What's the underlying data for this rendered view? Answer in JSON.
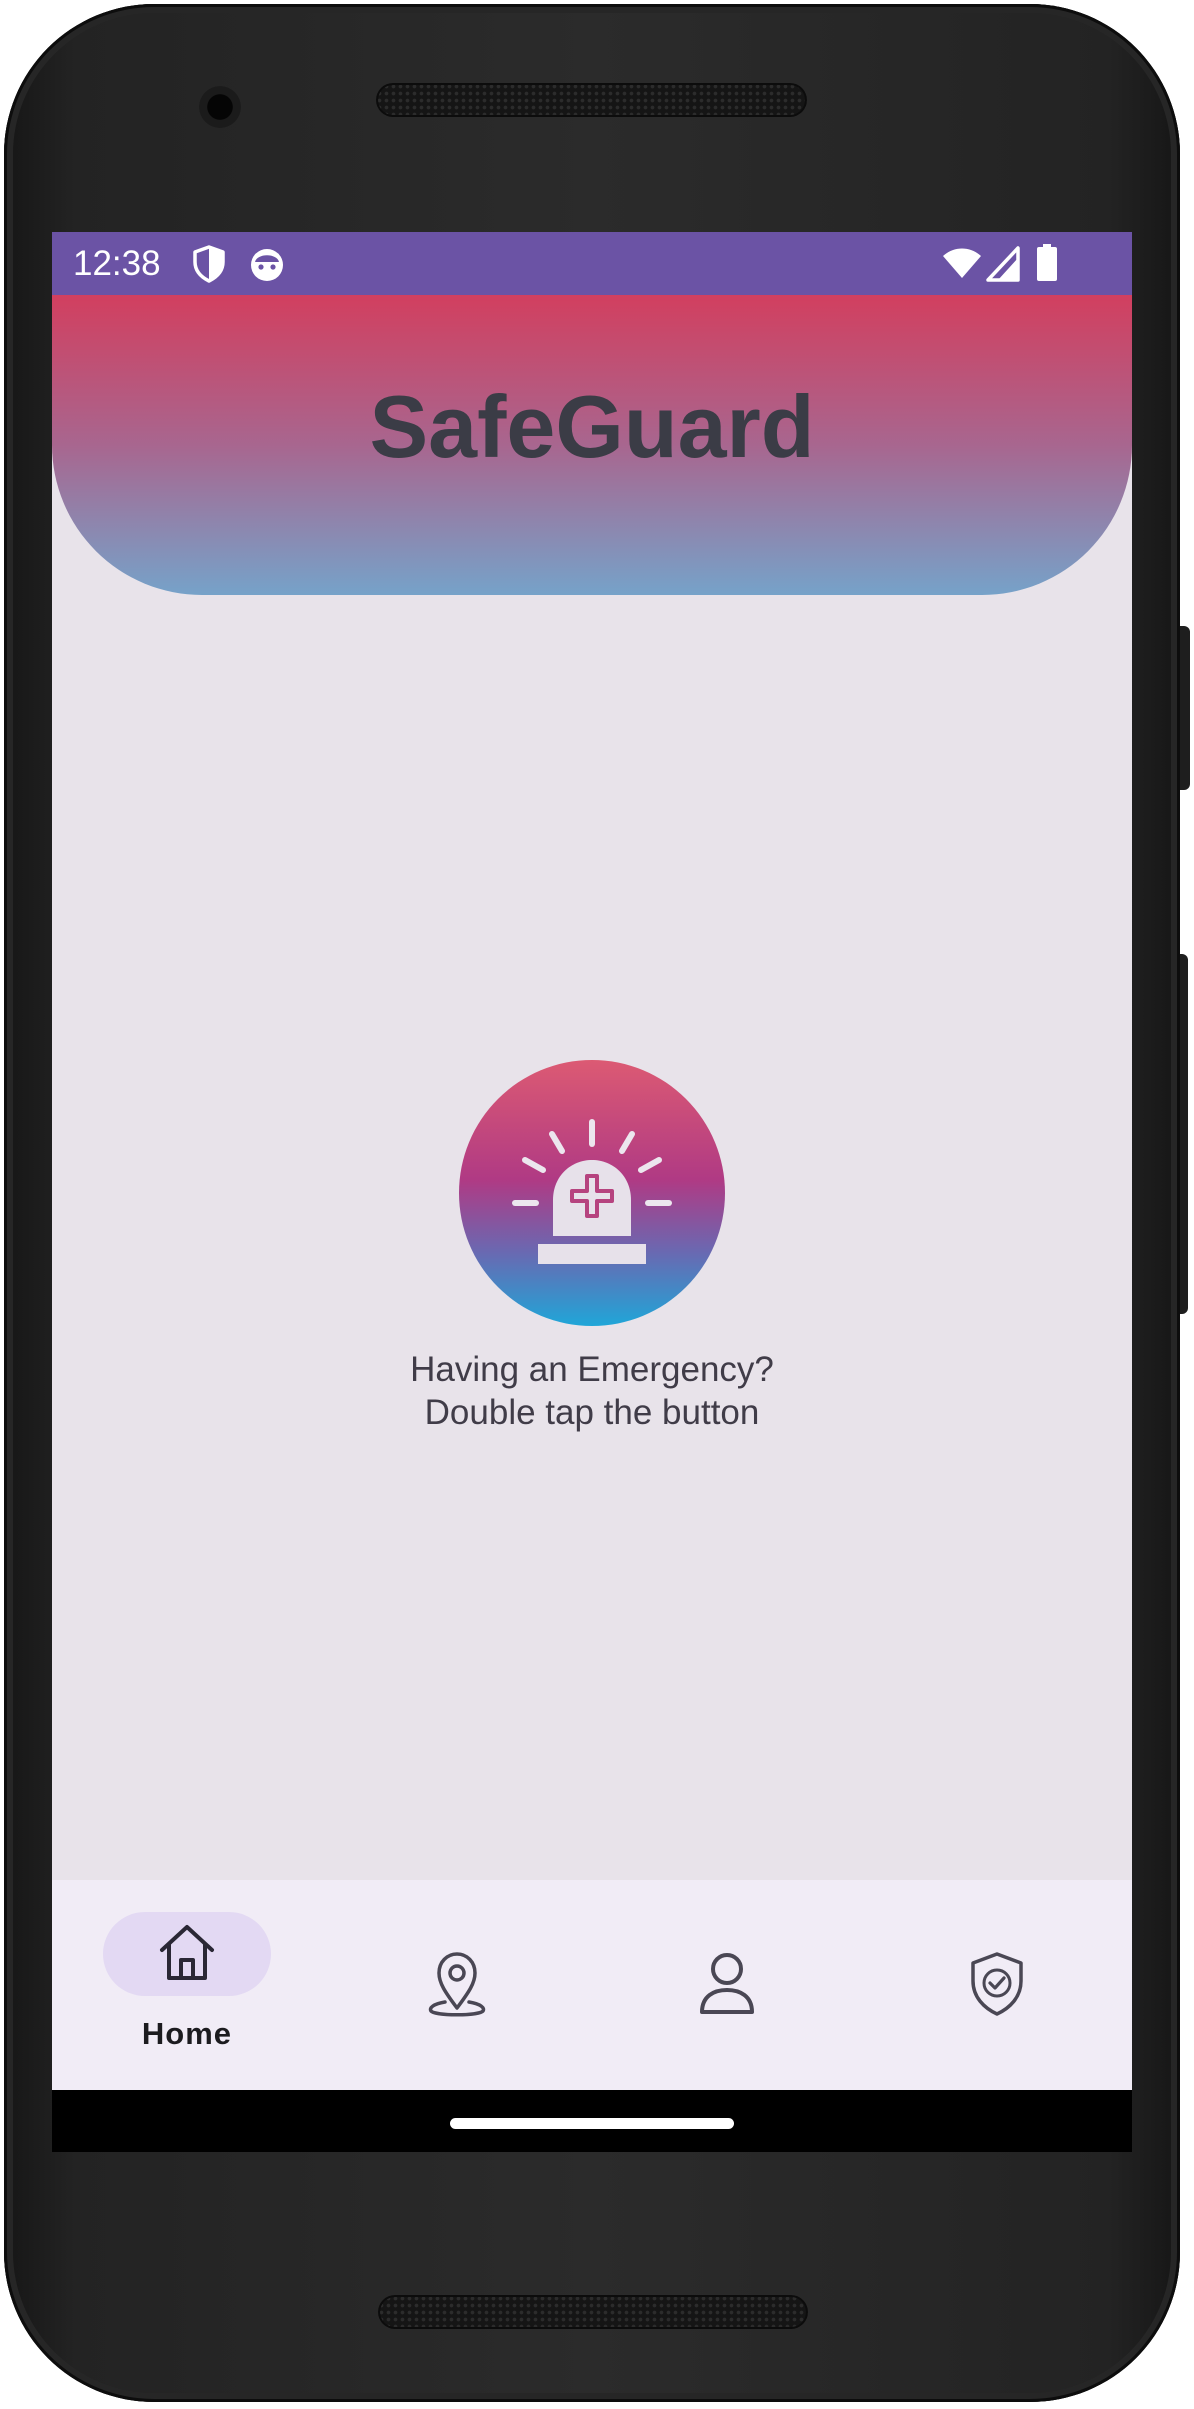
{
  "status_bar": {
    "time": "12:38",
    "left_icons": [
      "shield-icon",
      "face-icon"
    ],
    "right_icons": [
      "wifi-icon",
      "signal-icon",
      "battery-icon"
    ],
    "background": "#6b53a5"
  },
  "header": {
    "title": "SafeGuard",
    "gradient": [
      "#d23f5f",
      "#a8668f",
      "#76a2c9"
    ]
  },
  "emergency": {
    "icon": "siren-icon",
    "line1": "Having an Emergency?",
    "line2": "Double tap the button"
  },
  "bottom_nav": {
    "items": [
      {
        "icon": "home-icon",
        "label": "Home",
        "selected": true
      },
      {
        "icon": "location-pin-icon",
        "label": "",
        "selected": false
      },
      {
        "icon": "person-icon",
        "label": "",
        "selected": false
      },
      {
        "icon": "shield-check-icon",
        "label": "",
        "selected": false
      }
    ],
    "accent": "#e3d9f3"
  }
}
